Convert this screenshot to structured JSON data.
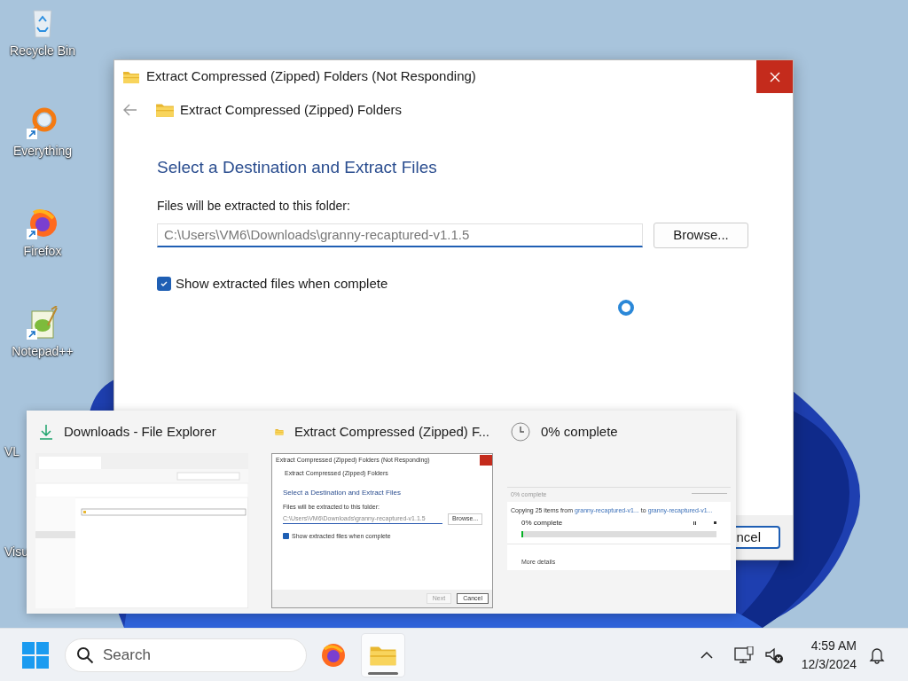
{
  "desktop_icons": [
    {
      "label": "Recycle Bin",
      "kind": "recycle"
    },
    {
      "label": "Everything",
      "kind": "everything"
    },
    {
      "label": "Firefox",
      "kind": "firefox"
    },
    {
      "label": "Notepad++",
      "kind": "notepad"
    },
    {
      "label": "VL",
      "kind": "covered"
    },
    {
      "label": "Visu",
      "kind": "covered"
    }
  ],
  "dialog": {
    "title": "Extract Compressed (Zipped) Folders (Not Responding)",
    "header": "Extract Compressed (Zipped) Folders",
    "heading": "Select a Destination and Extract Files",
    "field_label": "Files will be extracted to this folder:",
    "path": "C:\\Users\\VM6\\Downloads\\granny-recaptured-v1.1.5",
    "browse": "Browse...",
    "checkbox": {
      "label": "Show extracted files when complete",
      "checked": true
    },
    "cancel": "ncel"
  },
  "task_previews": [
    {
      "kind": "explorer",
      "title": "Downloads - File Explorer"
    },
    {
      "kind": "extract",
      "title": "Extract Compressed (Zipped) F...",
      "preview": {
        "title": "Extract Compressed (Zipped) Folders (Not Responding)",
        "header": "Extract Compressed (Zipped) Folders",
        "heading": "Select a Destination and Extract Files",
        "field_label": "Files will be extracted to this folder:",
        "path": "C:\\Users\\VM6\\Downloads\\granny-recaptured-v1.1.5",
        "browse": "Browse...",
        "checkbox": {
          "label": "Show extracted files when complete",
          "checked": true
        },
        "next": "Next",
        "cancel": "Cancel"
      }
    },
    {
      "kind": "progress",
      "title": "0% complete",
      "preview": {
        "title": "0% complete",
        "copying": "Copying 25 items from",
        "source": "granny-recaptured-v1...",
        "to": "to",
        "dest": "granny-recaptured-v1...",
        "status": "0% complete",
        "level": 0,
        "more": "More details"
      }
    }
  ],
  "taskbar": {
    "search_placeholder": "Search",
    "apps": [
      {
        "kind": "firefox",
        "selected": false
      },
      {
        "kind": "explorer",
        "selected": true
      }
    ],
    "time": "4:59 AM",
    "date": "12/3/2024"
  }
}
